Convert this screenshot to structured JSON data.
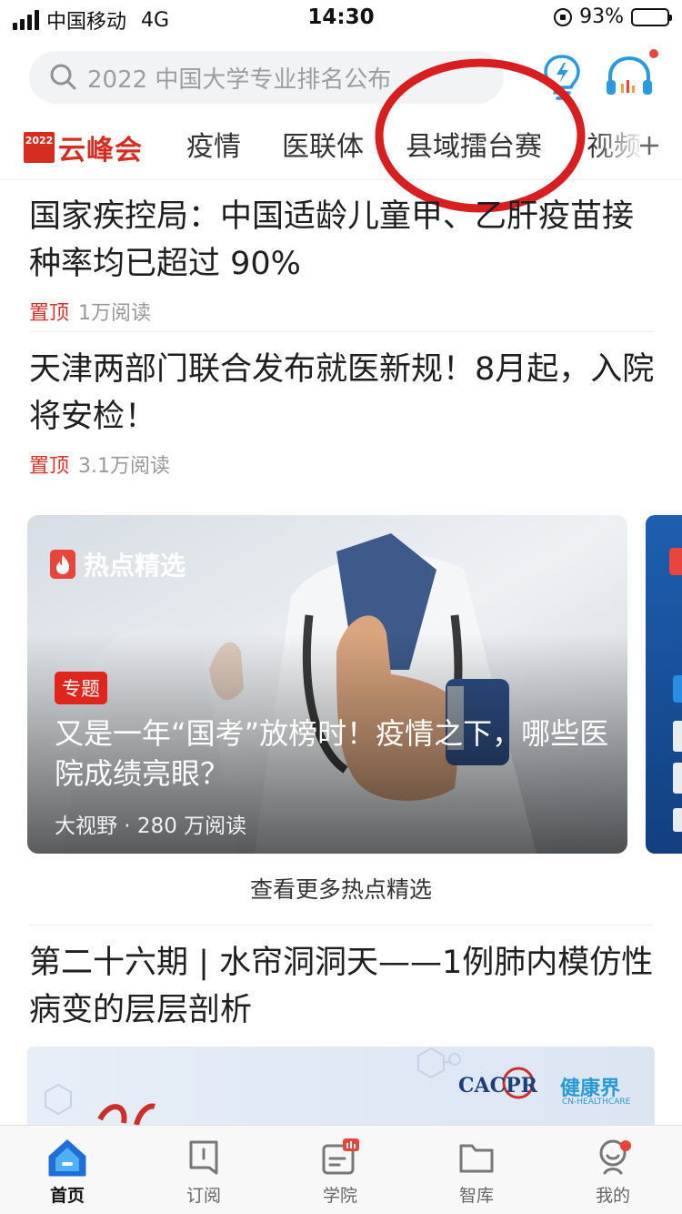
{
  "status_bar": {
    "carrier": "中国移动",
    "network": "4G",
    "time": "14:30",
    "battery_percent_text": "93%",
    "battery_level": 0.93,
    "icons": [
      "signal-icon",
      "orientation-lock-icon",
      "battery-icon"
    ]
  },
  "search": {
    "placeholder": "2022 中国大学专业排名公布",
    "icon": "search-icon"
  },
  "header_actions": {
    "bulb_icon": "lightbulb-icon",
    "headset_icon": "headset-icon"
  },
  "tabs": {
    "logo_year": "2022",
    "logo_text": "云峰会",
    "items": [
      "疫情",
      "医联体",
      "县域擂台赛",
      "视频"
    ],
    "more_icon": "plus-icon"
  },
  "articles": [
    {
      "title": "国家疾控局：中国适龄儿童甲、乙肝疫苗接种率均已超过 90%",
      "pin": "置顶",
      "reads": "1万阅读"
    },
    {
      "title": "天津两部门联合发布就医新规！8月起，入院将安检！",
      "pin": "置顶",
      "reads": "3.1万阅读"
    }
  ],
  "hot_card": {
    "badge": "热点精选",
    "tag": "专题",
    "title": "又是一年“国考”放榜时！疫情之下，哪些医院成绩亮眼？",
    "meta": "大视野 · 280 万阅读"
  },
  "more_link": "查看更多热点精选",
  "article3": {
    "title": "第二十六期 | 水帘洞洞天——1例肺内模仿性病变的层层剖析",
    "banner_logo_a": "CACPR",
    "banner_logo_b": "健康界",
    "banner_logo_c": "CN-HEALTHCARE"
  },
  "bottom_nav": {
    "items": [
      {
        "label": "首页",
        "icon": "home-icon"
      },
      {
        "label": "订阅",
        "icon": "bookmark-icon"
      },
      {
        "label": "学院",
        "icon": "academy-icon"
      },
      {
        "label": "智库",
        "icon": "folder-icon"
      },
      {
        "label": "我的",
        "icon": "profile-icon"
      }
    ]
  },
  "colors": {
    "accent_red": "#d6332b",
    "annotation_circle": "#d81e1e",
    "nav_active": "#1f6fd6"
  }
}
